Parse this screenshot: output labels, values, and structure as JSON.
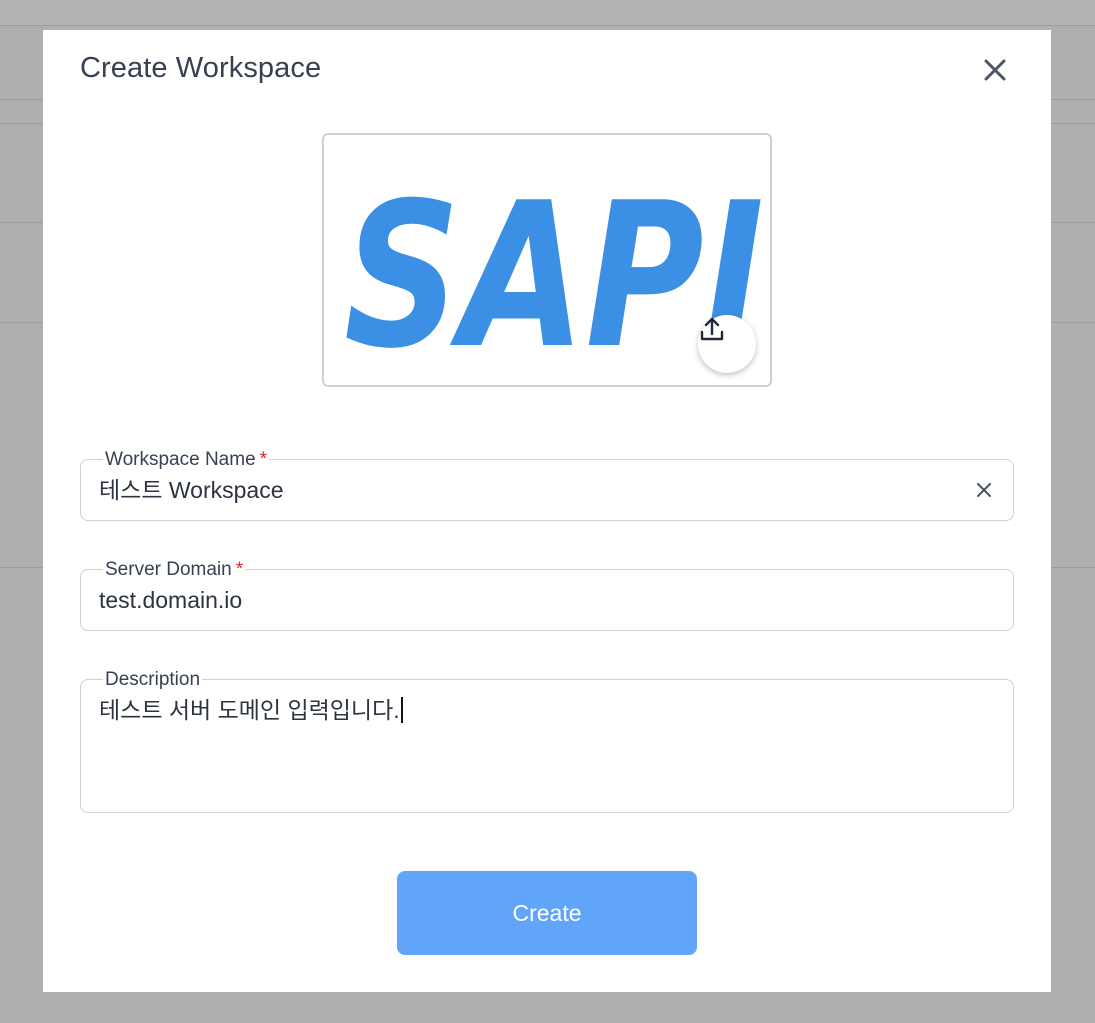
{
  "modal": {
    "title": "Create Workspace",
    "close_icon": "close-icon",
    "logo": {
      "image_text": "SAPI",
      "image_color": "#3b8fe5",
      "upload_icon": "upload-icon"
    },
    "fields": {
      "workspace_name": {
        "label": "Workspace Name",
        "required_mark": "*",
        "value": "테스트 Workspace",
        "clear_icon": "clear-icon"
      },
      "server_domain": {
        "label": "Server Domain",
        "required_mark": "*",
        "value": "test.domain.io"
      },
      "description": {
        "label": "Description",
        "value": "테스트 서버 도메인 입력입니다."
      }
    },
    "create_button": {
      "label": "Create",
      "color": "#60a5fa"
    }
  },
  "colors": {
    "overlay": "#afafaf",
    "required": "#dc2626",
    "text": "#374151"
  }
}
